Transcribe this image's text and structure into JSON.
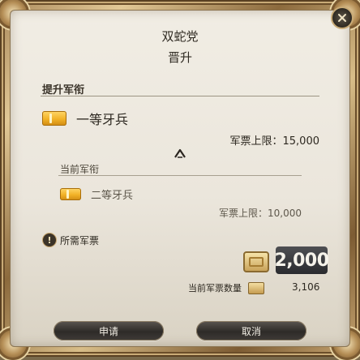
{
  "dialog": {
    "title": "双蛇党",
    "subtitle": "晋升"
  },
  "promotion": {
    "section_label": "提升军衔",
    "next_rank": {
      "label": "一等牙兵",
      "cap_label": "军票上限：15,000"
    },
    "current_section_label": "当前军衔",
    "current_rank": {
      "label": "二等牙兵",
      "cap_label": "军票上限：10,000"
    }
  },
  "cost": {
    "label": "所需军票",
    "amount": "2,000",
    "current_label": "当前军票数量",
    "current_value": "3,106"
  },
  "buttons": {
    "apply": "申请",
    "cancel": "取消"
  },
  "icons": {
    "close": "close-icon",
    "rank": "rank-insignia-icon",
    "up": "up-arrow-icon",
    "info": "info-icon",
    "seal": "company-seal-icon"
  },
  "colors": {
    "panel": "#ebe6dc",
    "frame_gold": "#c9a874",
    "rank_gold": "#f2b227",
    "button_dark": "#2e2b28"
  }
}
